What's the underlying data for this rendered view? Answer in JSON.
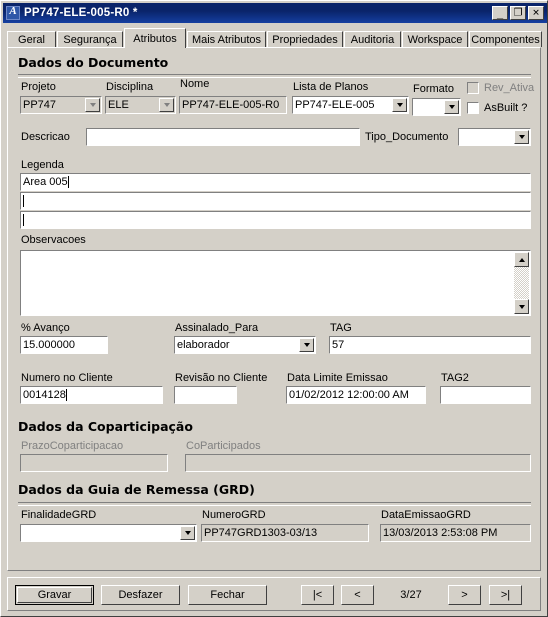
{
  "window": {
    "title": "PP747-ELE-005-R0 *",
    "app_icon": "autocad-a-icon",
    "controls": {
      "minimize": "minimize-icon",
      "maximize": "maximize-icon",
      "close": "close-icon"
    }
  },
  "tabs": [
    {
      "label": "Geral",
      "active": false
    },
    {
      "label": "Segurança",
      "active": false
    },
    {
      "label": "Atributos",
      "active": true
    },
    {
      "label": "Mais Atributos",
      "active": false
    },
    {
      "label": "Propriedades",
      "active": false
    },
    {
      "label": "Auditoria",
      "active": false
    },
    {
      "label": "Workspace",
      "active": false
    },
    {
      "label": "Componentes",
      "active": false
    }
  ],
  "sections": {
    "documento": {
      "title": "Dados do Documento",
      "projeto": {
        "label": "Projeto",
        "value": "PP747"
      },
      "disciplina": {
        "label": "Disciplina",
        "value": "ELE"
      },
      "nome": {
        "label": "Nome",
        "value": "PP747-ELE-005-R0"
      },
      "lista_planos": {
        "label": "Lista de Planos",
        "value": "PP747-ELE-005"
      },
      "formato": {
        "label": "Formato",
        "value": ""
      },
      "rev_ativa": {
        "label": "Rev_Ativa",
        "checked": false,
        "disabled": true
      },
      "asbuilt": {
        "label": "AsBuilt ?",
        "checked": false,
        "disabled": false
      },
      "descricao": {
        "label": "Descricao",
        "value": ""
      },
      "tipo_documento": {
        "label": "Tipo_Documento",
        "value": ""
      }
    },
    "legenda": {
      "label": "Legenda",
      "lines": [
        "Area 005",
        "",
        ""
      ]
    },
    "observacoes": {
      "label": "Observacoes",
      "value": ""
    },
    "avanco": {
      "percent": {
        "label": "% Avanço",
        "value": "15.000000"
      },
      "assinalado": {
        "label": "Assinalado_Para",
        "value": "elaborador"
      },
      "tag": {
        "label": "TAG",
        "value": "57"
      },
      "numero_cliente": {
        "label": "Numero no Cliente",
        "value": "0014128"
      },
      "revisao_cliente": {
        "label": "Revisão no Cliente",
        "value": ""
      },
      "data_limite": {
        "label": "Data Limite Emissao",
        "value": "01/02/2012 12:00:00 AM"
      },
      "tag2": {
        "label": "TAG2",
        "value": ""
      }
    },
    "coparticipacao": {
      "title": "Dados da Coparticipação",
      "prazo": {
        "label": "PrazoCoparticipacao",
        "value": ""
      },
      "coparticipados": {
        "label": "CoParticipados",
        "value": ""
      }
    },
    "grd": {
      "title": "Dados da Guia de Remessa (GRD)",
      "finalidade": {
        "label": "FinalidadeGRD",
        "value": ""
      },
      "numero": {
        "label": "NumeroGRD",
        "value": "PP747GRD1303-03/13"
      },
      "data_emissao": {
        "label": "DataEmissaoGRD",
        "value": "13/03/2013 2:53:08 PM"
      }
    }
  },
  "footer": {
    "gravar": "Gravar",
    "desfazer": "Desfazer",
    "fechar": "Fechar",
    "nav_first": "|<",
    "nav_prev": "<",
    "page_counter": "3/27",
    "nav_next": ">",
    "nav_last": ">|"
  }
}
